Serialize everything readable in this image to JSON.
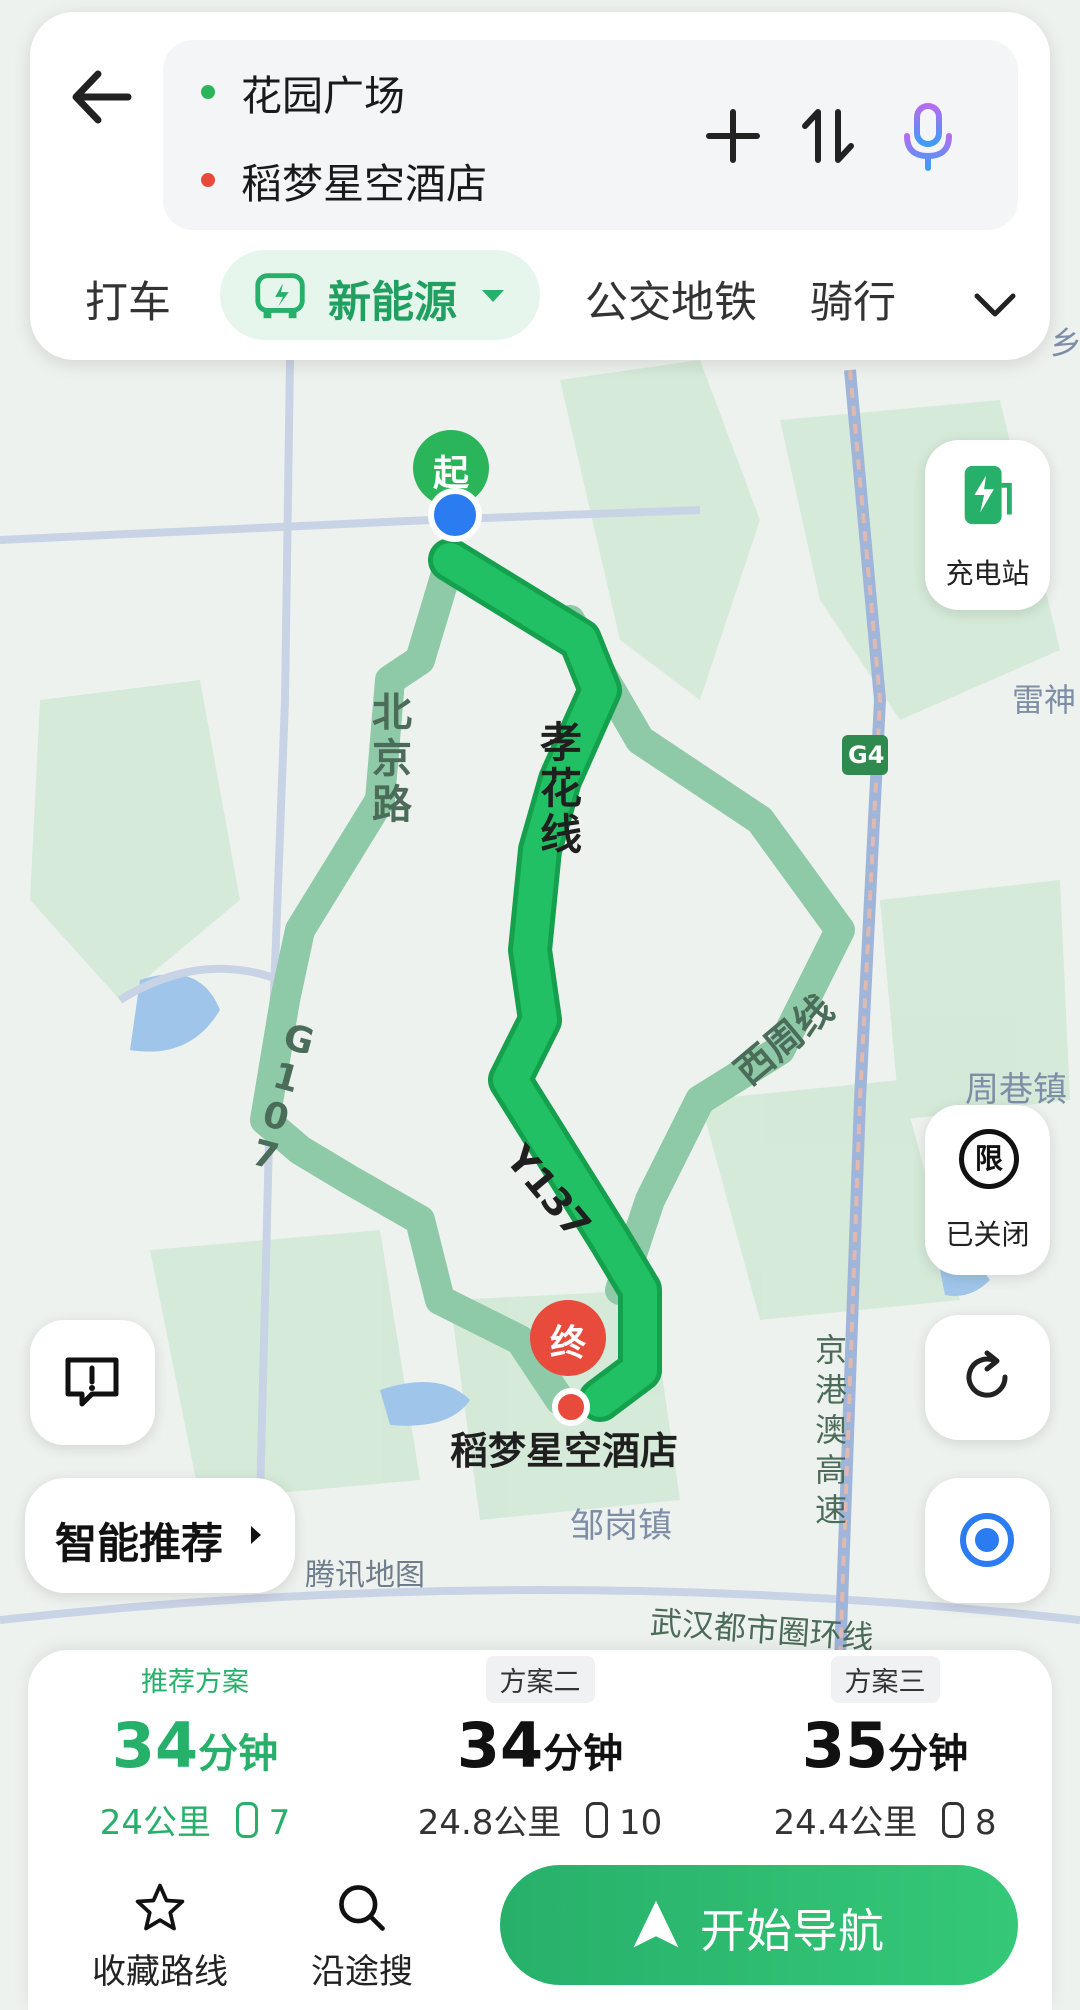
{
  "route": {
    "from": "花园广场",
    "to": "稻梦星空酒店"
  },
  "modes": [
    "打车",
    "新能源",
    "公交地铁",
    "骑行"
  ],
  "side_buttons": {
    "charging": "充电站",
    "limit": "已关闭",
    "limit_icon_text": "限"
  },
  "map_labels": {
    "start_marker": "起",
    "end_marker": "终",
    "destination": "稻梦星空酒店",
    "road_xiaohua": "孝花线",
    "road_beijing": "北京路",
    "road_g107": "G107",
    "road_y137": "Y137",
    "road_xizhou": "西周线",
    "highway_g4": "G4",
    "jinggang": "京港澳高速",
    "wuhan_ring": "武汉都市圈环线",
    "zougang": "邹岗镇",
    "zhouxiang": "周巷镇",
    "leishen": "雷神",
    "xiangxiang": "乡",
    "watermark": "腾讯地图"
  },
  "smart_recommend": "智能推荐",
  "plans": [
    {
      "tag": "推荐方案",
      "time": "34",
      "unit": "分钟",
      "distance": "24公里",
      "lights": "7"
    },
    {
      "tag": "方案二",
      "time": "34",
      "unit": "分钟",
      "distance": "24.8公里",
      "lights": "10"
    },
    {
      "tag": "方案三",
      "time": "35",
      "unit": "分钟",
      "distance": "24.4公里",
      "lights": "8"
    }
  ],
  "actions": {
    "save_route": "收藏路线",
    "search_along": "沿途搜",
    "start_nav": "开始导航"
  },
  "colors": {
    "accent": "#27b06a",
    "route_main": "#1fb45a",
    "route_alt": "#8ec9a8",
    "start_dot": "#2bb55b",
    "end_dot": "#e84a3c"
  }
}
